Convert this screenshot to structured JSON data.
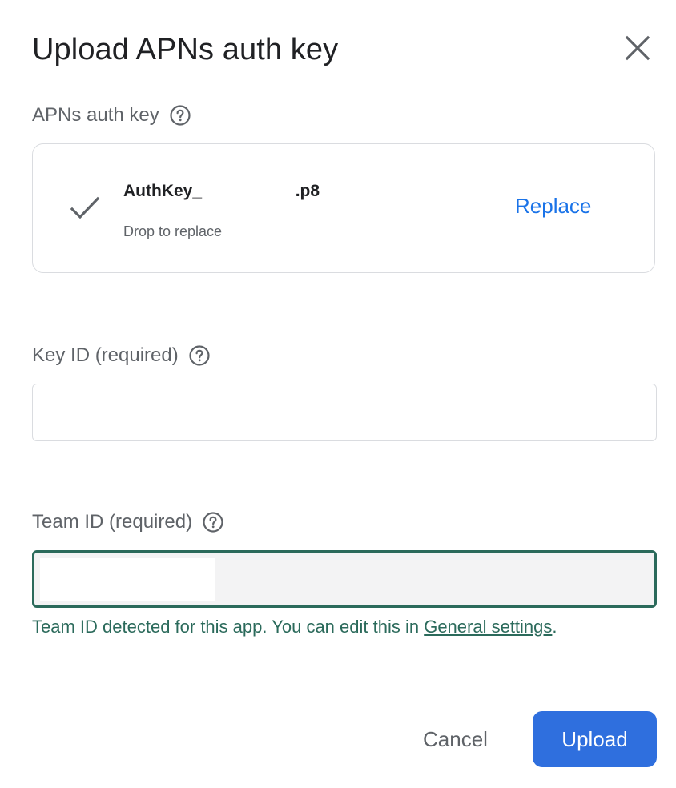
{
  "dialog": {
    "title": "Upload APNs auth key",
    "close_icon": "close-icon"
  },
  "auth_key": {
    "label": "APNs auth key",
    "help_icon": "help-circle-icon",
    "file_name": "AuthKey_                    .p8",
    "hint": "Drop to replace",
    "replace_label": "Replace",
    "status_icon": "checkmark-icon"
  },
  "key_id": {
    "label": "Key ID (required)",
    "help_icon": "help-circle-icon",
    "value": ""
  },
  "team_id": {
    "label": "Team ID (required)",
    "help_icon": "help-circle-icon",
    "value": "",
    "helper_prefix": "Team ID detected for this app. You can edit this in ",
    "helper_link": "General settings",
    "helper_suffix": "."
  },
  "actions": {
    "cancel_label": "Cancel",
    "upload_label": "Upload"
  },
  "colors": {
    "accent": "#1a73e8",
    "primary_button": "#2f6fde",
    "focus_teal": "#2b6a5b",
    "muted_text": "#5f6368"
  }
}
